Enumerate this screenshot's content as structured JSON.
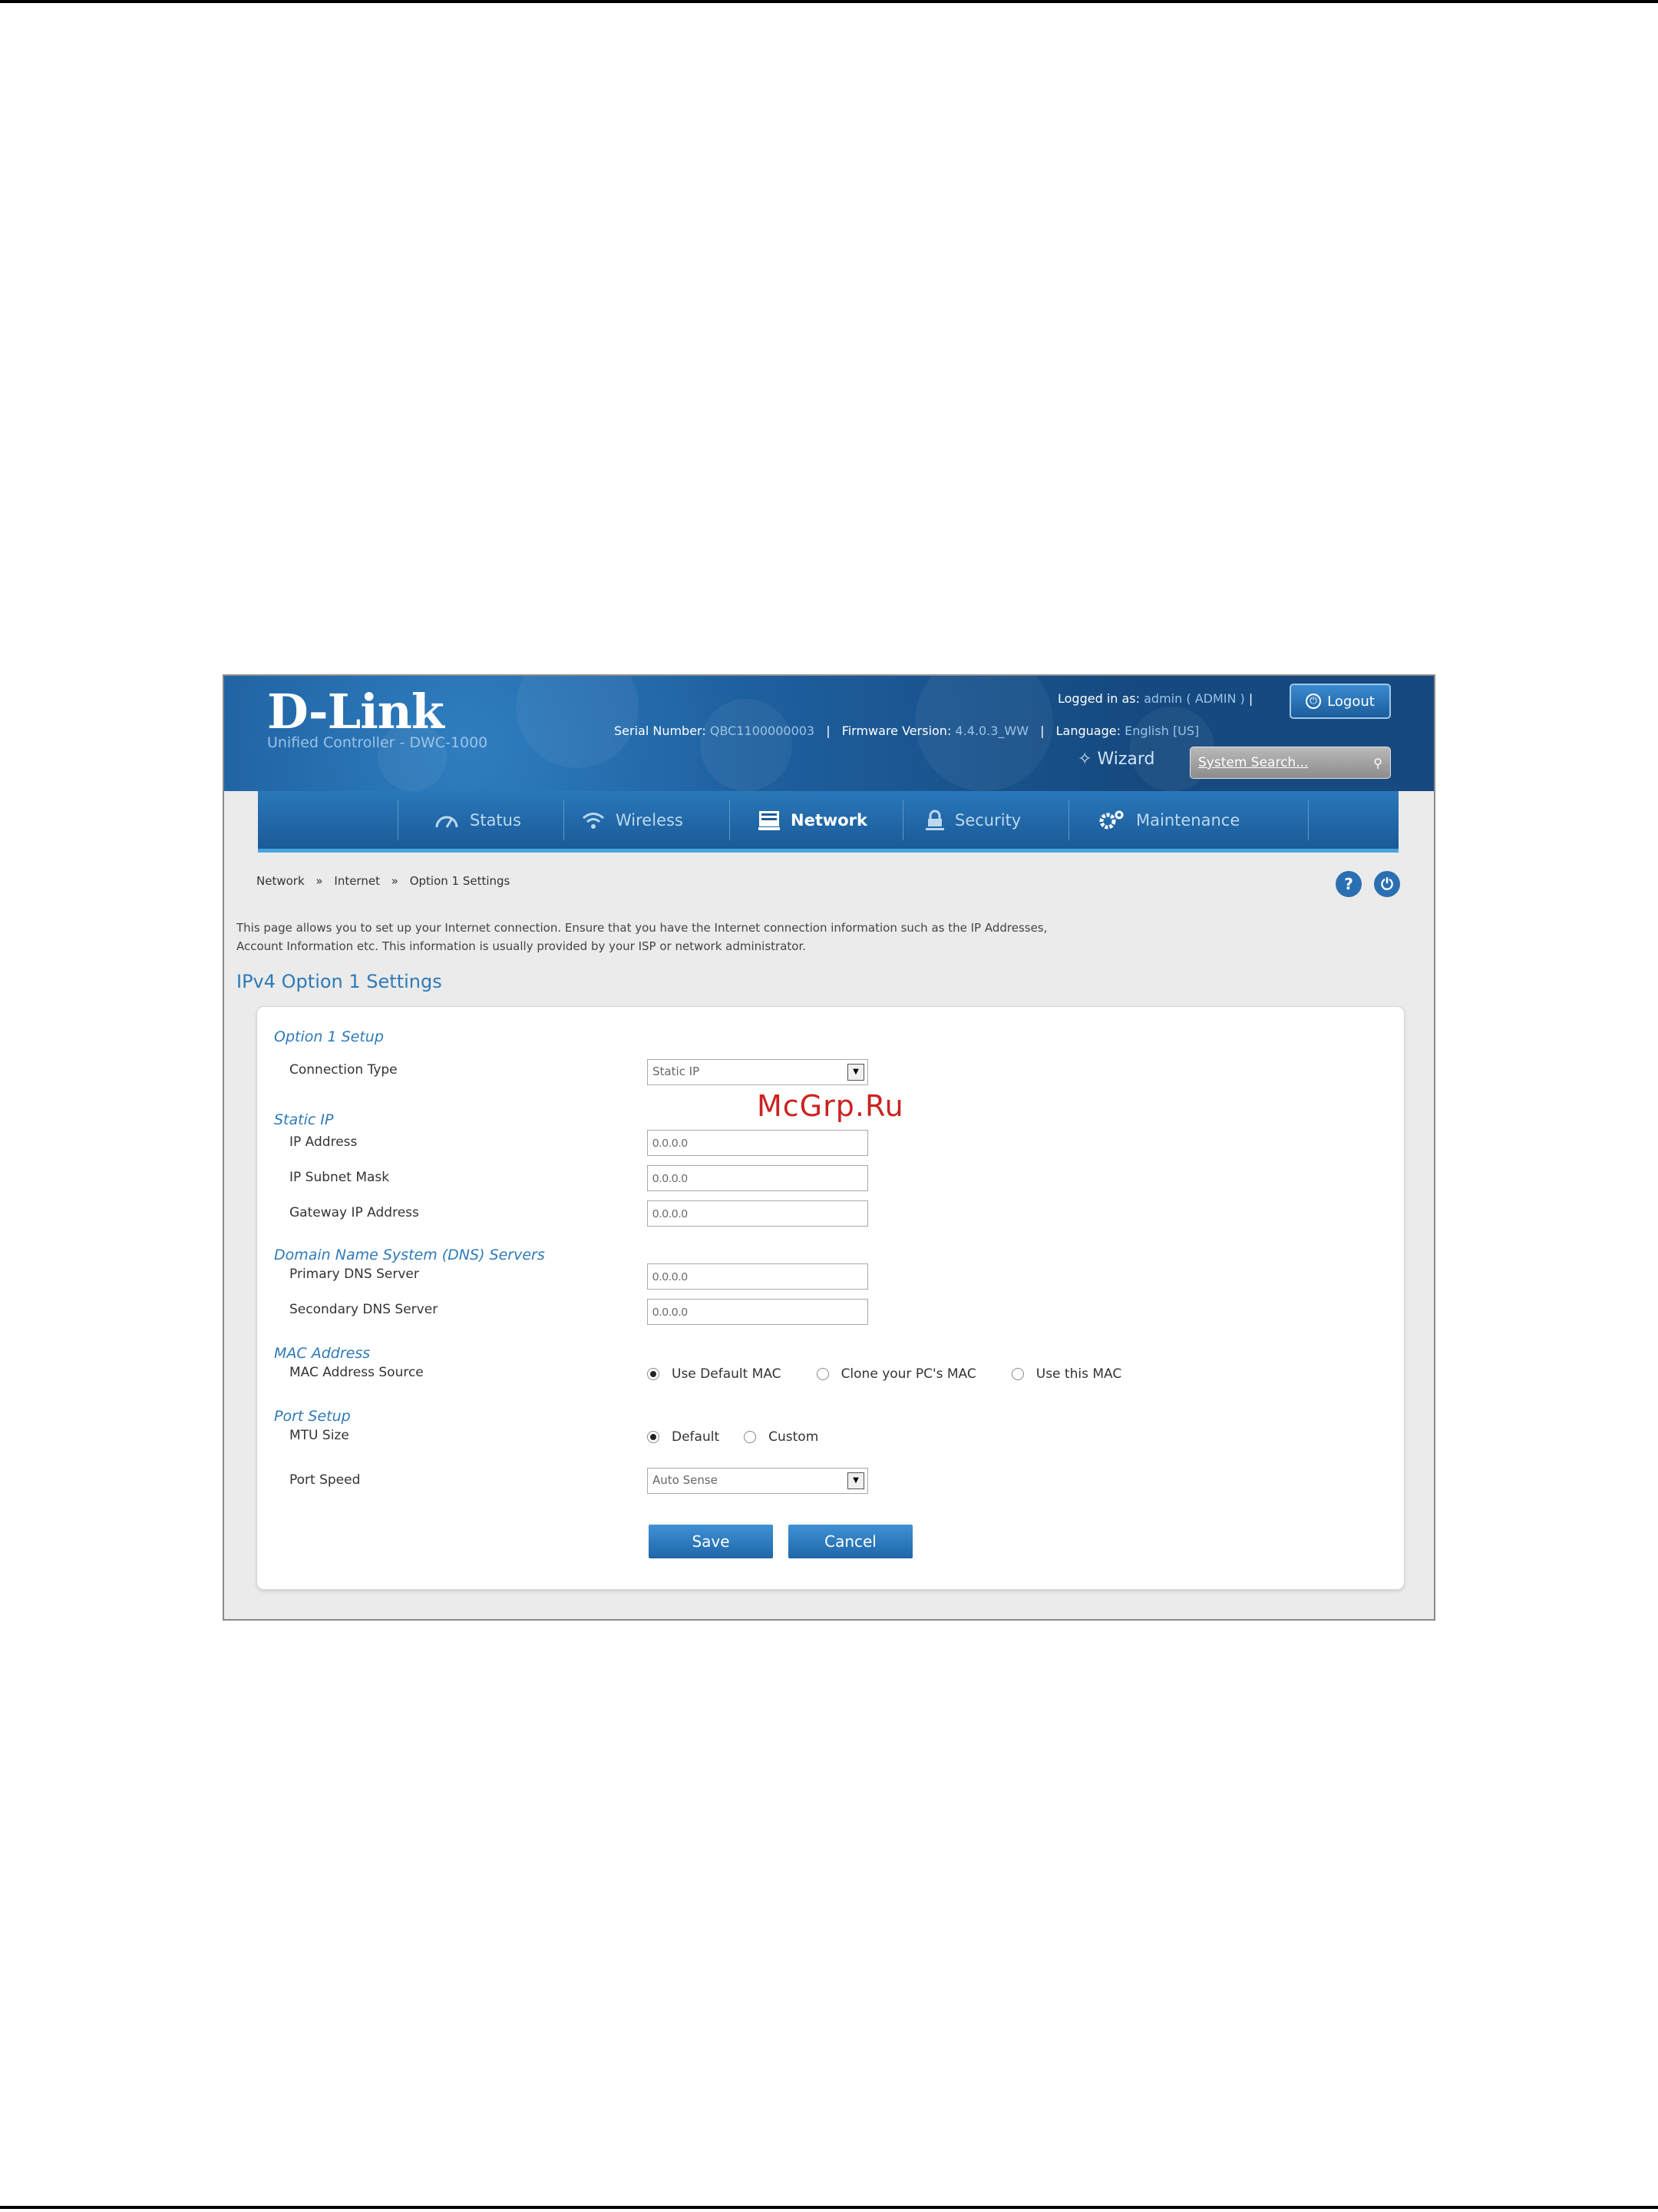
{
  "header": {
    "logo": "D-Link",
    "subtitle": "Unified Controller - DWC-1000",
    "serial_label": "Serial Number:",
    "serial_value": "QBC1100000003",
    "firmware_label": "Firmware Version:",
    "firmware_value": "4.4.0.3_WW",
    "language_label": "Language:",
    "language_value": "English [US]",
    "logged_label": "Logged in as:",
    "logged_user": "admin",
    "logged_role": "( ADMIN )",
    "logout_label": "Logout",
    "wizard_label": "Wizard",
    "search_placeholder": "System Search..."
  },
  "nav": {
    "items": [
      {
        "label": "Status",
        "icon": "gauge-icon"
      },
      {
        "label": "Wireless",
        "icon": "wifi-icon"
      },
      {
        "label": "Network",
        "icon": "network-icon",
        "active": true
      },
      {
        "label": "Security",
        "icon": "lock-icon"
      },
      {
        "label": "Maintenance",
        "icon": "gears-icon"
      }
    ]
  },
  "breadcrumb": {
    "items": [
      "Network",
      "Internet",
      "Option 1 Settings"
    ],
    "separator": "»"
  },
  "description": {
    "line1": "This page allows you to set up your Internet connection. Ensure that you have the Internet connection information such as the IP Addresses,",
    "line2": "Account Information etc. This information is usually provided by your ISP or network administrator."
  },
  "page_title": "IPv4 Option 1 Settings",
  "form": {
    "option_setup": {
      "title": "Option 1 Setup",
      "connection_type_label": "Connection Type",
      "connection_type_value": "Static IP"
    },
    "static_ip": {
      "title": "Static IP",
      "ip_label": "IP Address",
      "ip_value": "0.0.0.0",
      "mask_label": "IP Subnet Mask",
      "mask_value": "0.0.0.0",
      "gateway_label": "Gateway IP Address",
      "gateway_value": "0.0.0.0"
    },
    "dns": {
      "title": "Domain Name System (DNS) Servers",
      "primary_label": "Primary DNS Server",
      "primary_value": "0.0.0.0",
      "secondary_label": "Secondary DNS Server",
      "secondary_value": "0.0.0.0"
    },
    "mac": {
      "title": "MAC Address",
      "source_label": "MAC Address Source",
      "options": [
        "Use Default MAC",
        "Clone your PC's MAC",
        "Use this MAC"
      ],
      "selected": "Use Default MAC"
    },
    "port": {
      "title": "Port Setup",
      "mtu_label": "MTU Size",
      "mtu_options": [
        "Default",
        "Custom"
      ],
      "mtu_selected": "Default",
      "speed_label": "Port Speed",
      "speed_value": "Auto Sense"
    },
    "save_label": "Save",
    "cancel_label": "Cancel"
  },
  "watermark": "McGrp.Ru"
}
